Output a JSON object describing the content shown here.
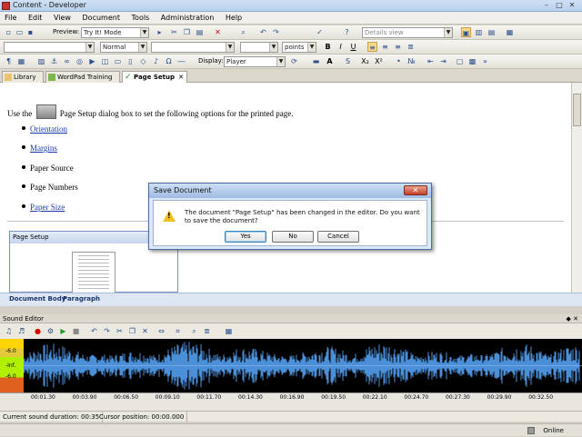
{
  "window": {
    "title": "Content - Developer",
    "min": "–",
    "max": "□",
    "close": "✕"
  },
  "menu": [
    "File",
    "Edit",
    "View",
    "Document",
    "Tools",
    "Administration",
    "Help"
  ],
  "toolbar1": {
    "preview_label": "Preview:",
    "preview_value": "Try It! Mode",
    "view_value": "Details view"
  },
  "toolbar2": {
    "style_value": "Normal",
    "size_unit": "points",
    "bold": "B",
    "italic": "I",
    "underline": "U"
  },
  "toolbar3": {
    "display_label": "Display:",
    "display_value": "Player",
    "sub": "X₂",
    "sup": "X²"
  },
  "doc_tabs": [
    {
      "label": "Library",
      "active": false
    },
    {
      "label": "WordPad Training",
      "active": false
    },
    {
      "label": "Page Setup",
      "active": true,
      "close": "✕"
    }
  ],
  "document": {
    "intro_before": "Use the",
    "intro_after": "Page Setup dialog box to set the following options for the printed page.",
    "items": [
      {
        "text": "Orientation",
        "link": true
      },
      {
        "text": "Margins",
        "link": true
      },
      {
        "text": "Paper Source",
        "link": false
      },
      {
        "text": "Page Numbers",
        "link": false
      },
      {
        "text": "Paper Size",
        "link": true
      }
    ],
    "panel_title": "Page Setup"
  },
  "body_bar": {
    "item1": "Document Body",
    "item2": "Paragraph"
  },
  "sound_editor": {
    "title": "Sound Editor",
    "pin": "◆ ✕",
    "meter_labels": [
      "-6.0",
      "-Inf.",
      "-6.0"
    ],
    "time_ticks": [
      "00:01.30",
      "00:03.90",
      "00:06.50",
      "00:09.10",
      "00:11.70",
      "00:14.30",
      "00:16.90",
      "00:19.50",
      "00:22.10",
      "00:24.70",
      "00:27.30",
      "00:29.90",
      "00:32.50"
    ],
    "duration": "Current sound duration: 00:35",
    "cursor": "Cursor position: 00:00.000"
  },
  "status": {
    "online": "Online"
  },
  "dialog": {
    "title": "Save Document",
    "message": "The document \"Page Setup\" has been changed in the editor. Do you want to save the document?",
    "yes": "Yes",
    "no": "No",
    "cancel": "Cancel",
    "close": "✕"
  },
  "colors": {
    "link": "#1a3aa8",
    "waveform": "#4a8fd8",
    "warning": "#f0c020"
  }
}
